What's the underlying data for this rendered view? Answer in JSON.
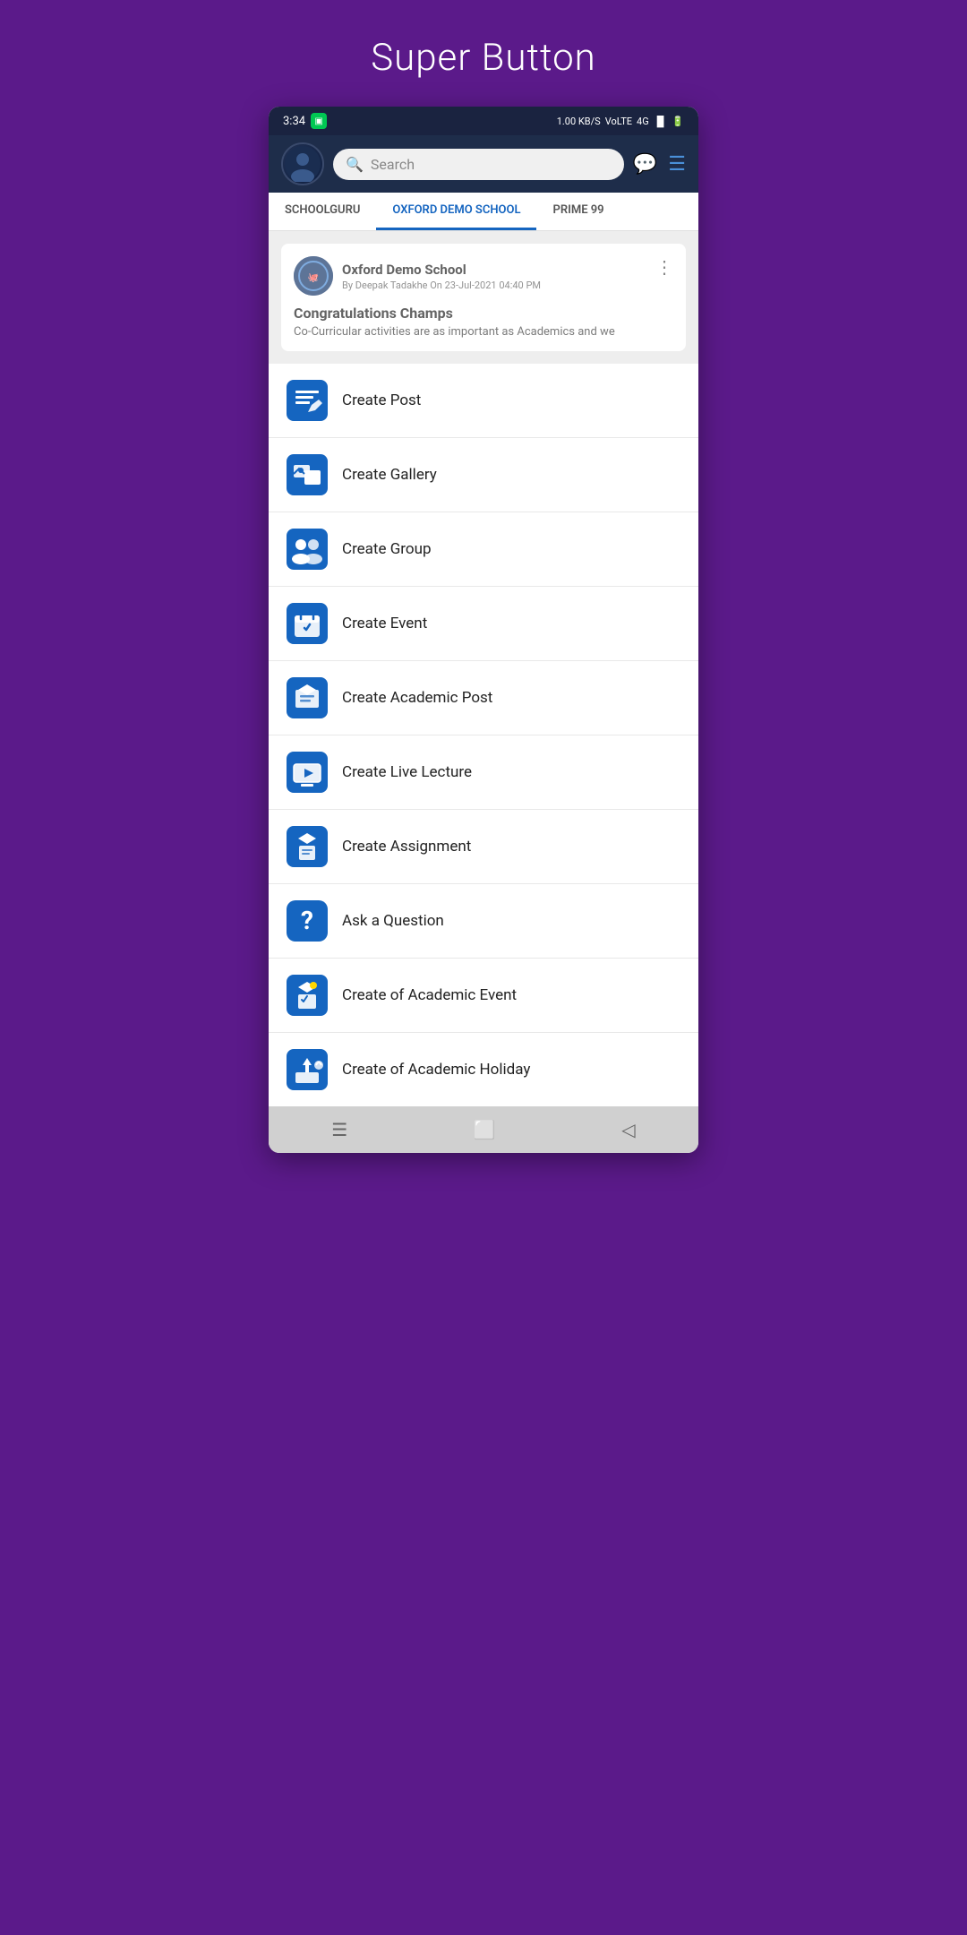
{
  "page": {
    "title": "Super Button",
    "background_color": "#5b1a8a"
  },
  "status_bar": {
    "time": "3:34",
    "network_speed": "1.00 KB/S",
    "network_type": "VoLTE",
    "signal": "4G",
    "battery": "4"
  },
  "header": {
    "search_placeholder": "Search",
    "avatar_label": "user avatar"
  },
  "tabs": [
    {
      "label": "SCHOOLGURU",
      "active": false
    },
    {
      "label": "OXFORD DEMO SCHOOL",
      "active": true
    },
    {
      "label": "PRIME 99",
      "active": false
    }
  ],
  "post": {
    "school_name": "Oxford Demo School",
    "author": "By Deepak Tadakhe On 23-Jul-2021 04:40 PM",
    "title": "Congratulations Champs",
    "description": "Co-Curricular activities are as important as Academics and we"
  },
  "menu_items": [
    {
      "id": "create-post",
      "label": "Create Post",
      "icon": "post-icon"
    },
    {
      "id": "create-gallery",
      "label": "Create Gallery",
      "icon": "gallery-icon"
    },
    {
      "id": "create-group",
      "label": "Create Group",
      "icon": "group-icon"
    },
    {
      "id": "create-event",
      "label": "Create Event",
      "icon": "event-icon"
    },
    {
      "id": "create-academic-post",
      "label": "Create Academic Post",
      "icon": "academic-post-icon"
    },
    {
      "id": "create-live-lecture",
      "label": "Create Live Lecture",
      "icon": "live-lecture-icon"
    },
    {
      "id": "create-assignment",
      "label": "Create Assignment",
      "icon": "assignment-icon"
    },
    {
      "id": "ask-question",
      "label": "Ask a Question",
      "icon": "question-icon"
    },
    {
      "id": "create-academic-event",
      "label": "Create of Academic Event",
      "icon": "academic-event-icon"
    },
    {
      "id": "create-academic-holiday",
      "label": "Create of Academic Holiday",
      "icon": "academic-holiday-icon"
    }
  ],
  "bottom_nav": {
    "items": [
      "menu",
      "square",
      "back"
    ]
  }
}
